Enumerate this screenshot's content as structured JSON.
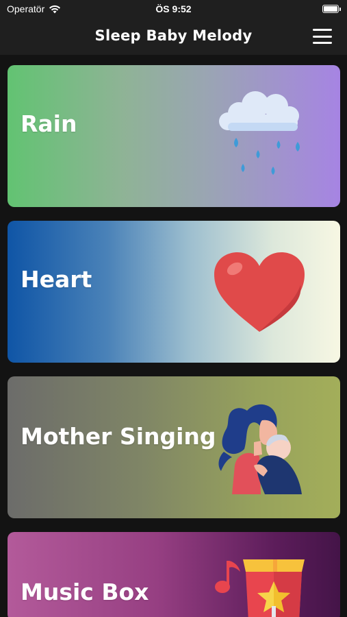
{
  "status_bar": {
    "carrier": "Operatör",
    "time": "ÖS 9:52",
    "icons": [
      "wifi-icon",
      "battery-icon"
    ]
  },
  "header": {
    "title": "Sleep Baby Melody",
    "menu_icon": "hamburger-menu-icon"
  },
  "cards": [
    {
      "label": "Rain",
      "icon": "rain-cloud-icon"
    },
    {
      "label": "Heart",
      "icon": "heart-icon"
    },
    {
      "label": "Mother Singing",
      "icon": "mother-baby-icon"
    },
    {
      "label": "Music Box",
      "icon": "music-box-icon"
    }
  ],
  "colors": {
    "background": "#131313",
    "header": "#1f1f1f",
    "heart_red": "#e04a4a",
    "raindrop_blue": "#3f9bd8"
  }
}
